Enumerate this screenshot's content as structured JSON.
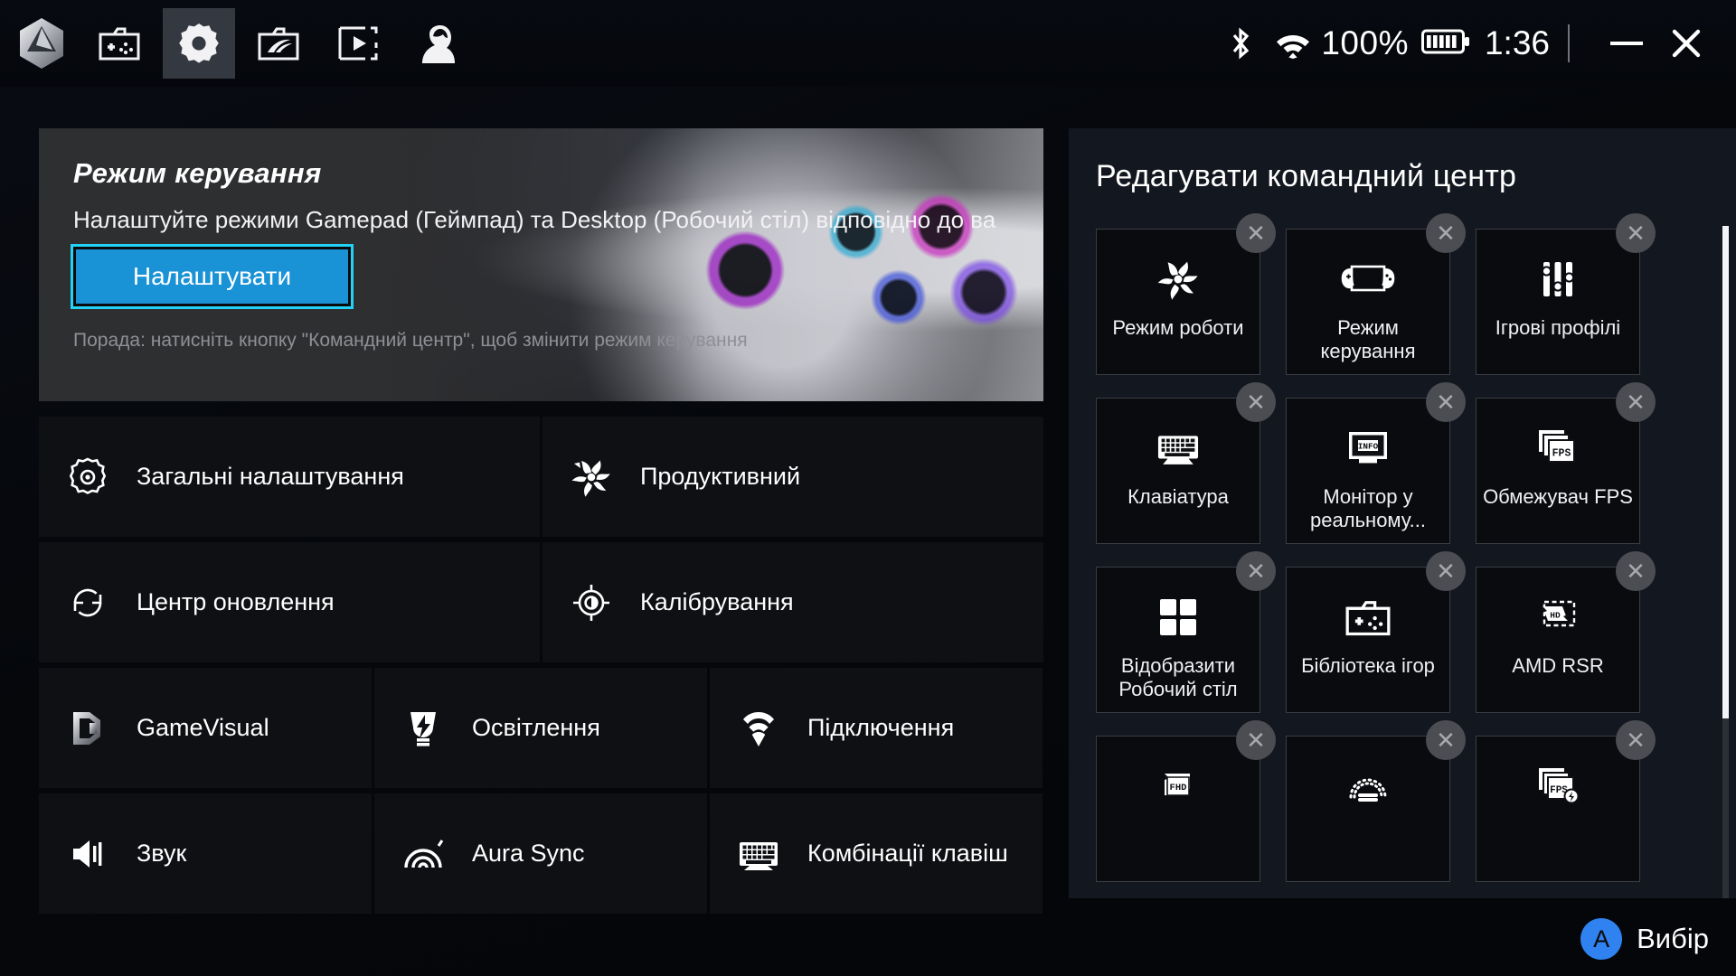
{
  "window": {
    "minimize_label": "minimize",
    "close_label": "close"
  },
  "topbar": {
    "nav": [
      {
        "name": "armoury-logo",
        "icon": "armoury-crate-hex-logo"
      },
      {
        "name": "game-library",
        "icon": "game-library-folder-icon"
      },
      {
        "name": "settings",
        "icon": "gear-icon",
        "active": true
      },
      {
        "name": "rog-content",
        "icon": "rog-folder-icon"
      },
      {
        "name": "media-highlights",
        "icon": "video-frame-icon"
      },
      {
        "name": "user-profile",
        "icon": "user-avatar-icon"
      }
    ],
    "status": {
      "bluetooth_icon": "bluetooth-icon",
      "wifi_icon": "wifi-icon",
      "battery_percent": "100%",
      "battery_icon": "battery-full-icon",
      "clock": "1:36"
    }
  },
  "banner": {
    "title": "Режим керування",
    "description": "Налаштуйте режими Gamepad (Геймпад) та Desktop (Робочий стіл) відповідно до ва",
    "button_label": "Налаштувати",
    "tip": "Порада: натисніть кнопку \"Командний центр\", щоб змінити режим керування"
  },
  "settings_tiles": [
    {
      "label": "Загальні налаштування",
      "icon": "gear-outline-icon",
      "size": "w2"
    },
    {
      "label": "Продуктивний",
      "icon": "fan-performance-icon",
      "size": "w2"
    },
    {
      "label": "Центр оновлення",
      "icon": "refresh-circular-icon",
      "size": "w2"
    },
    {
      "label": "Калібрування",
      "icon": "crosshair-calibration-icon",
      "size": "w2"
    },
    {
      "label": "GameVisual",
      "icon": "gamevisual-icon",
      "size": "w3"
    },
    {
      "label": "Освітлення",
      "icon": "lighting-bolt-icon",
      "size": "w3"
    },
    {
      "label": "Підключення",
      "icon": "connectivity-wifi-icon",
      "size": "w3"
    },
    {
      "label": "Звук",
      "icon": "speaker-sound-icon",
      "size": "w3"
    },
    {
      "label": "Aura Sync",
      "icon": "aura-sync-icon",
      "size": "w3"
    },
    {
      "label": "Комбінації клавіш",
      "icon": "keyboard-shortcuts-icon",
      "size": "w3"
    }
  ],
  "command_center": {
    "title": "Редагувати командний центр",
    "remove_glyph": "✕",
    "items": [
      {
        "label": "Режим роботи",
        "icon": "fan-performance-icon"
      },
      {
        "label": "Режим керування",
        "icon": "handheld-device-icon"
      },
      {
        "label": "Ігрові профілі",
        "icon": "sliders-icon"
      },
      {
        "label": "Клавіатура",
        "icon": "keyboard-icon"
      },
      {
        "label": "Монітор у реальному...",
        "icon": "info-monitor-icon"
      },
      {
        "label": "Обмежувач FPS",
        "icon": "fps-stack-icon"
      },
      {
        "label": "Відобразити Робочий стіл",
        "icon": "desktop-windows-icon"
      },
      {
        "label": "Бібліотека ігор",
        "icon": "game-library-folder-icon"
      },
      {
        "label": "AMD RSR",
        "icon": "hd-upscale-icon"
      },
      {
        "label": "",
        "icon": "fhd-resolution-icon"
      },
      {
        "label": "",
        "icon": "brightness-gauge-icon"
      },
      {
        "label": "",
        "icon": "fps-boost-icon"
      }
    ]
  },
  "bottom_hint": {
    "button_glyph": "A",
    "label": "Вибір"
  }
}
